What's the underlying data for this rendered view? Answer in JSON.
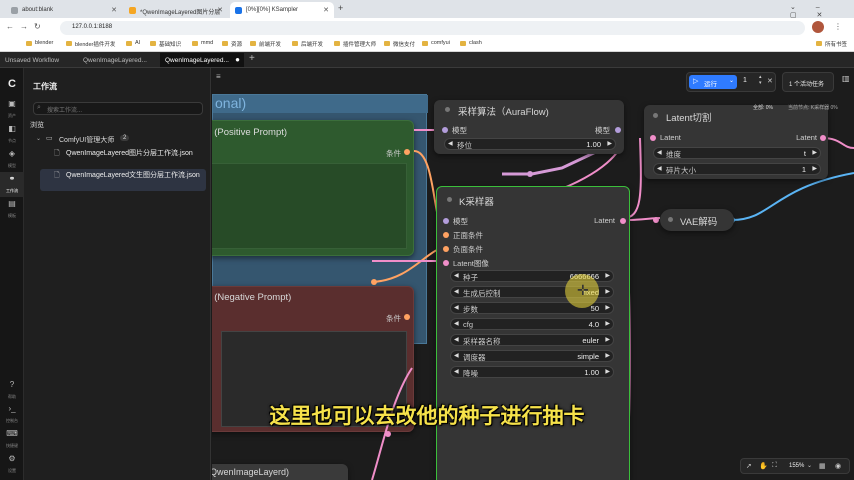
{
  "browser": {
    "tabs": [
      {
        "title": "about:blank",
        "color": "#9aa0a6"
      },
      {
        "title": "*QwenImageLayered图片分层",
        "color": "#f5a623"
      },
      {
        "title": "[0%][0%] KSampler",
        "color": "#1a73e8"
      }
    ],
    "url": "127.0.0.1:8188",
    "bookmarks": [
      "blender",
      "blender插件开发",
      "AI",
      "基础知识",
      "mmd",
      "资源",
      "前端开发",
      "后端开发",
      "插件管理大师",
      "微信支付",
      "comfyui",
      "clash"
    ],
    "all_bookmarks": "所有书签"
  },
  "app": {
    "workflow_tabs": [
      "Unsaved Workflow",
      "QwenImageLayered...",
      "QwenImageLayered..."
    ],
    "sidebar_icons": [
      {
        "icon": "comfy-logo-icon",
        "label": ""
      },
      {
        "icon": "assets-icon",
        "label": "资产"
      },
      {
        "icon": "nodes-icon",
        "label": "节点"
      },
      {
        "icon": "models-icon",
        "label": "模型"
      },
      {
        "icon": "workflow-icon",
        "label": "工作流"
      },
      {
        "icon": "templates-icon",
        "label": "模板"
      }
    ],
    "sidebar_bottom": [
      {
        "icon": "help-icon",
        "label": "帮助"
      },
      {
        "icon": "console-icon",
        "label": "控制台"
      },
      {
        "icon": "shortcuts-icon",
        "label": "快捷键"
      },
      {
        "icon": "settings-icon",
        "label": "设置"
      }
    ],
    "panel": {
      "title": "工作流",
      "search_placeholder": "搜索工作流...",
      "browse_label": "浏览",
      "folder": "ComfyUI管理大师",
      "folder_count": "2",
      "files": [
        "QwenImageLayered图片分层工作流.json",
        "QwenImageLayered文生图分层工作流.json"
      ]
    },
    "run_button": "运行",
    "queue_count": "1",
    "active_tasks": "1 个活动任务",
    "progress_text": "全部: 0%",
    "current_node": "当前节点: K采样器 0%",
    "zoom": "155%"
  },
  "canvas": {
    "group_title": "onal)",
    "positive_node": {
      "title": "de (Positive Prompt)",
      "output": "条件"
    },
    "negative_node": {
      "title": "de (Negative Prompt)",
      "output": "条件"
    },
    "bottom_node": {
      "title": "QwenImageLayerd)"
    },
    "aura_node": {
      "title": "采样算法（AuraFlow)",
      "input": "模型",
      "output": "模型",
      "widget_name": "移位",
      "widget_value": "1.00"
    },
    "latent_cut_node": {
      "title": "Latent切割",
      "input": "Latent",
      "output": "Latent",
      "widgets": [
        {
          "name": "维度",
          "value": "t"
        },
        {
          "name": "碎片大小",
          "value": "1"
        }
      ]
    },
    "vae_node": {
      "title": "VAE解码"
    },
    "ksampler": {
      "title": "K采样器",
      "inputs": [
        "模型",
        "正面条件",
        "负面条件",
        "Latent图像"
      ],
      "output": "Latent",
      "widgets": [
        {
          "name": "种子",
          "value": "6666666"
        },
        {
          "name": "生成后控制",
          "value": "fixed"
        },
        {
          "name": "步数",
          "value": "50"
        },
        {
          "name": "cfg",
          "value": "4.0"
        },
        {
          "name": "采样器名称",
          "value": "euler"
        },
        {
          "name": "调度器",
          "value": "simple"
        },
        {
          "name": "降噪",
          "value": "1.00"
        }
      ]
    }
  },
  "subtitle": "这里也可以去改他的种子进行抽卡",
  "colors": {
    "accent": "#2f7bff",
    "ksampler_border": "#3bbf3b",
    "wire_pink": "#f08ec9",
    "wire_orange": "#ffa262",
    "wire_blue": "#5ab4f4",
    "subtitle": "#f6e24a"
  }
}
